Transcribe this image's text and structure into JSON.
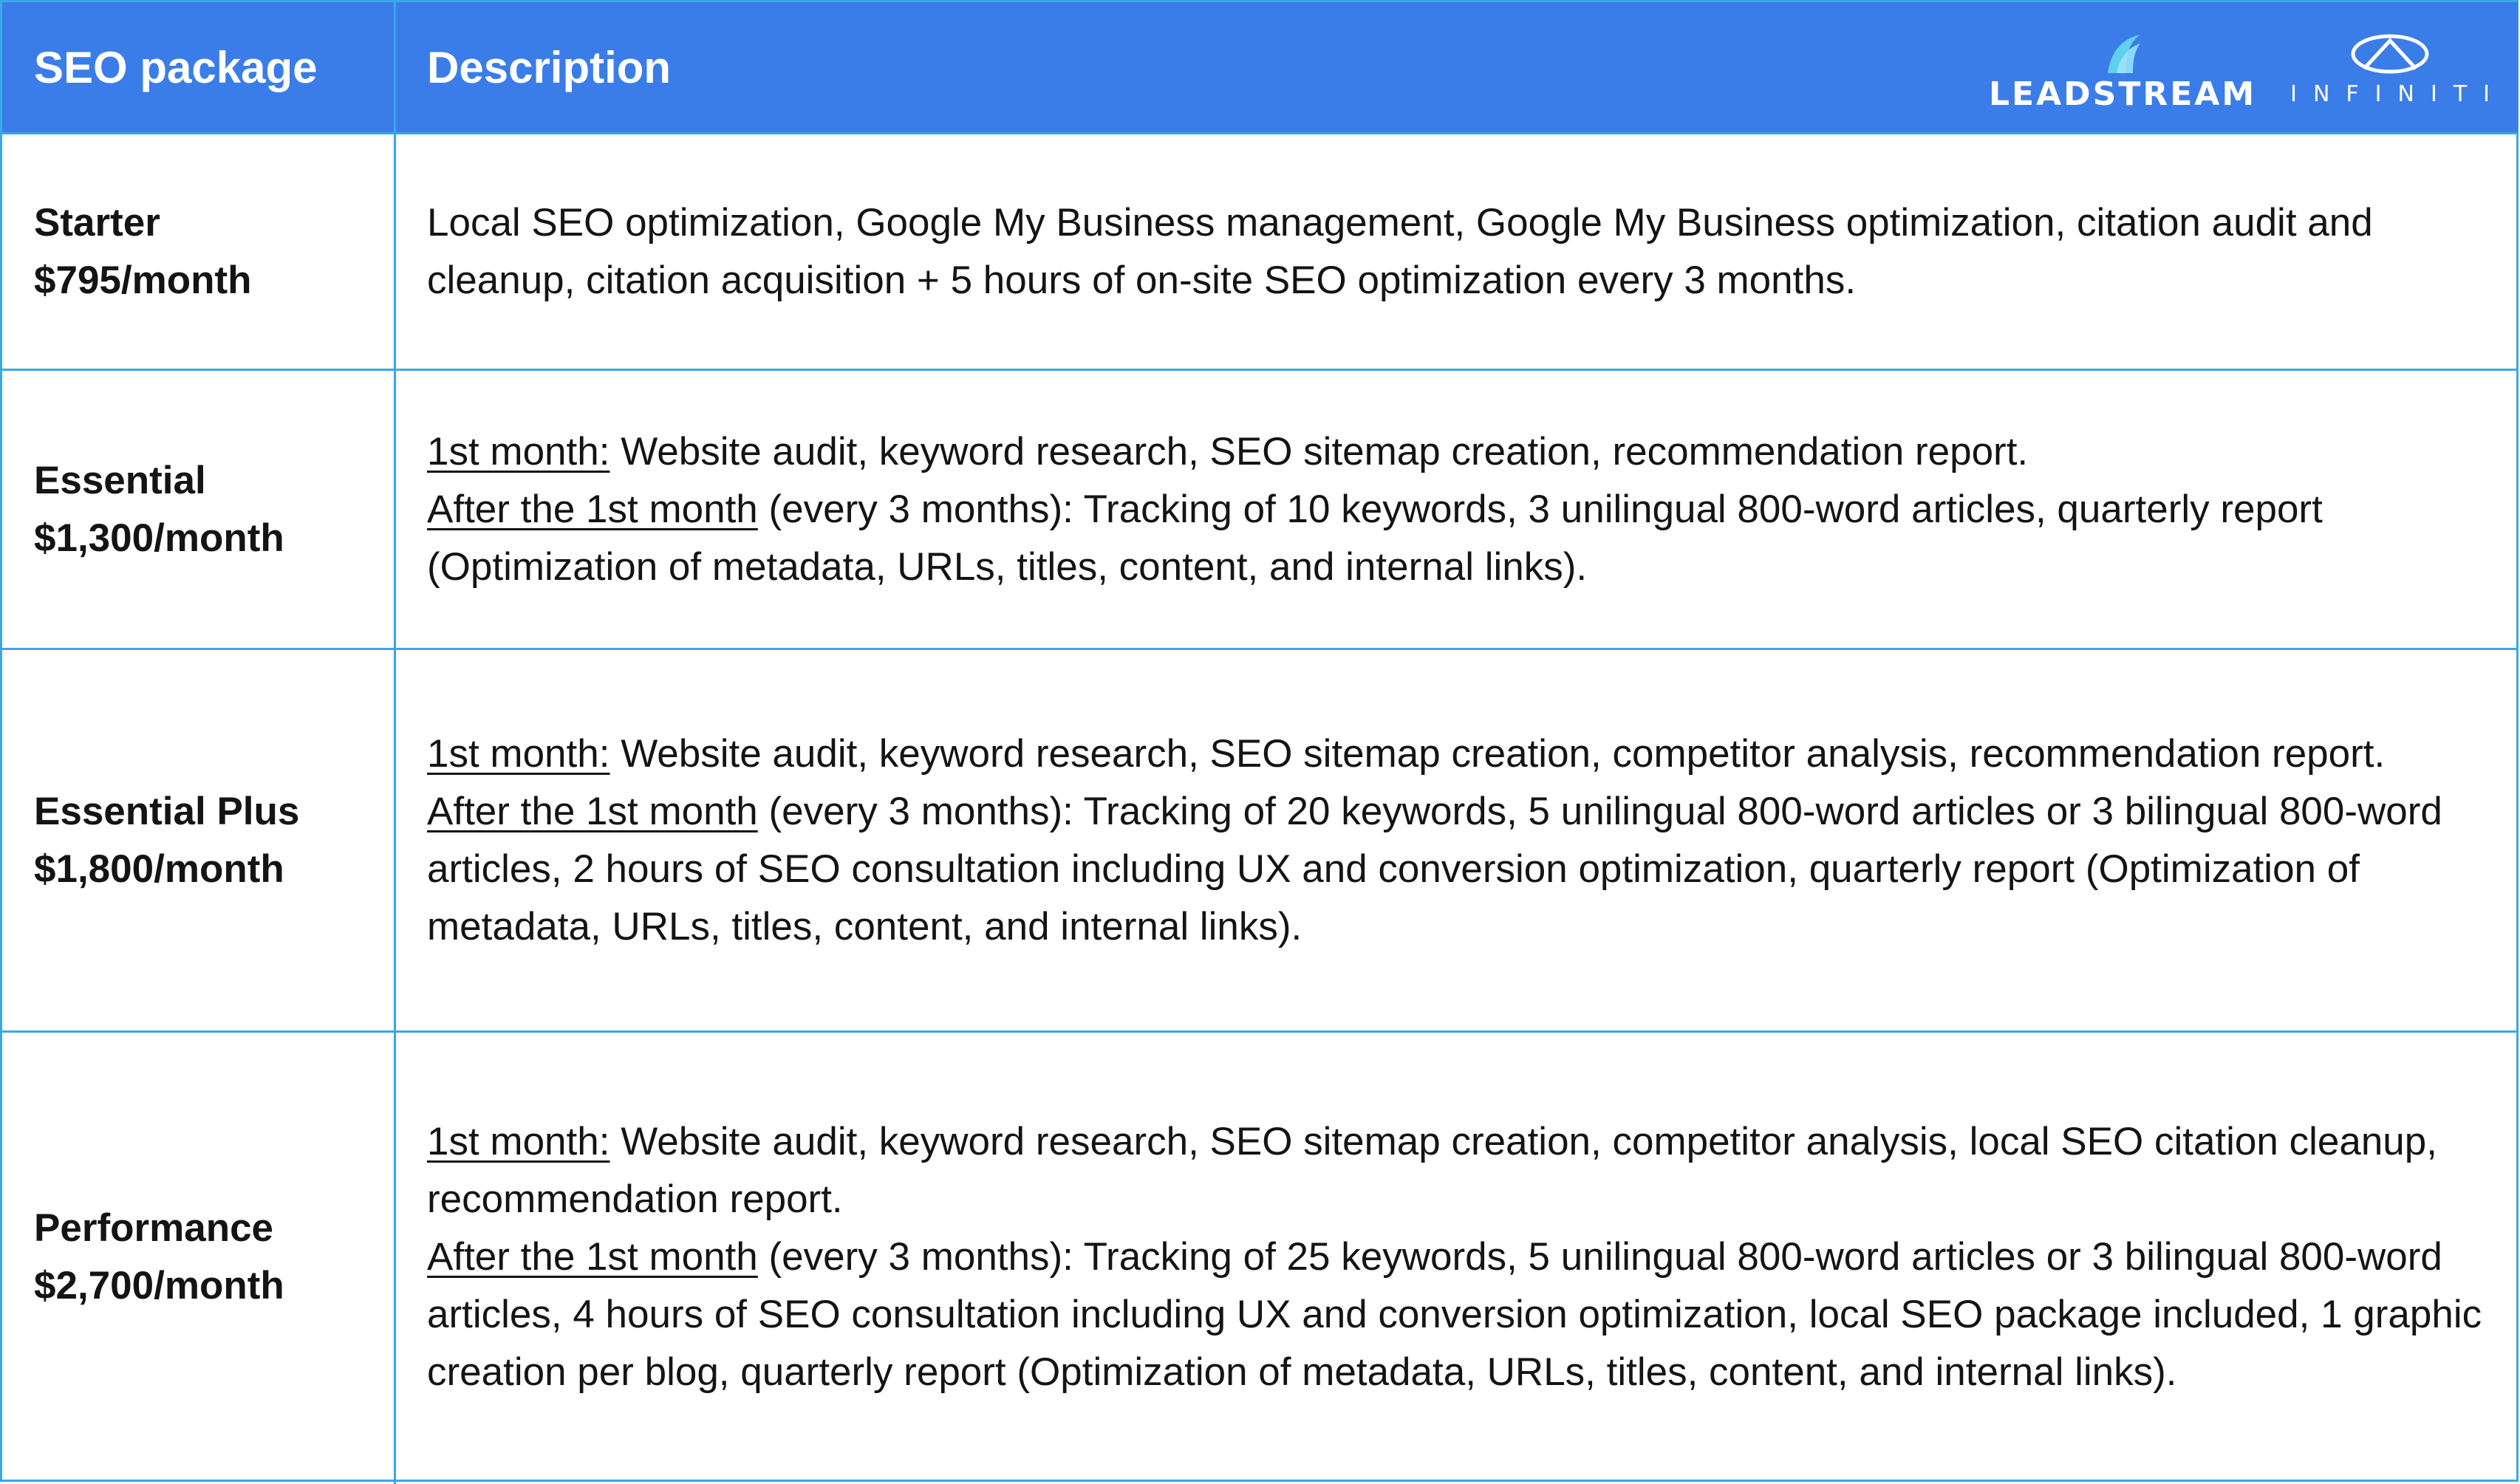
{
  "header": {
    "col_package": "SEO package",
    "col_description": "Description",
    "logos": {
      "leadstream": "LEADSTREAM",
      "infiniti": "INFINITI"
    }
  },
  "rows": [
    {
      "name": "Starter",
      "price": "$795/month",
      "paragraphs": [
        {
          "label": "",
          "text": "Local SEO optimization, Google My Business management, Google My Business optimization, citation audit and cleanup, citation acquisition + 5 hours of on-site SEO optimization every 3 months."
        }
      ]
    },
    {
      "name": "Essential",
      "price": "$1,300/month",
      "paragraphs": [
        {
          "label": "1st month:",
          "text": " Website audit, keyword research, SEO sitemap creation, recommendation report."
        },
        {
          "label": "After the 1st month",
          "text": " (every 3 months): Tracking of 10 keywords, 3 unilingual 800-word articles, quarterly report (Optimization of metadata, URLs, titles, content, and internal links)."
        }
      ]
    },
    {
      "name": "Essential Plus",
      "price": "$1,800/month",
      "paragraphs": [
        {
          "label": "1st month:",
          "text": " Website audit, keyword research, SEO sitemap creation, competitor analysis, recommendation report."
        },
        {
          "label": "After the 1st month",
          "text": " (every 3 months): Tracking of 20 keywords, 5 unilingual 800-word articles or 3 bilingual 800-word articles, 2 hours of SEO consultation including UX and conversion optimization, quarterly report (Optimization of metadata, URLs, titles, content, and internal links)."
        }
      ]
    },
    {
      "name": "Performance",
      "price": "$2,700/month",
      "paragraphs": [
        {
          "label": "1st month:",
          "text": " Website audit, keyword research, SEO sitemap creation, competitor analysis, local SEO citation cleanup, recommendation report."
        },
        {
          "label": "After the 1st month",
          "text": " (every 3 months): Tracking of 25 keywords, 5 unilingual 800-word articles or 3 bilingual 800-word articles, 4 hours of SEO consultation including UX and conversion optimization, local SEO package included, 1 graphic creation per blog, quarterly report (Optimization of metadata, URLs, titles, content, and internal links)."
        }
      ]
    }
  ],
  "colors": {
    "header_bg": "#3b7de8",
    "border": "#3aa7e6",
    "header_text": "#ffffff",
    "body_text": "#141414"
  }
}
